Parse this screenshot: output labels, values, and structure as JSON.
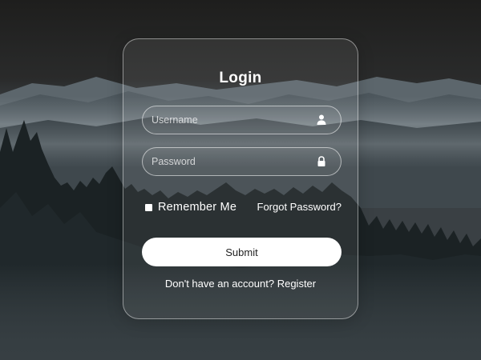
{
  "login": {
    "title": "Login",
    "username_placeholder": "Username",
    "password_placeholder": "Password",
    "username_icon": "user-icon",
    "password_icon": "lock-icon",
    "remember_label": "Remember Me",
    "remember_checked": false,
    "forgot_label": "Forgot Password?",
    "submit_label": "Submit",
    "register_prompt": "Don't have an account?",
    "register_label": "Register"
  },
  "colors": {
    "text": "#ffffff",
    "button_bg": "#ffffff",
    "button_text": "#222222",
    "card_border": "#ffffff"
  }
}
